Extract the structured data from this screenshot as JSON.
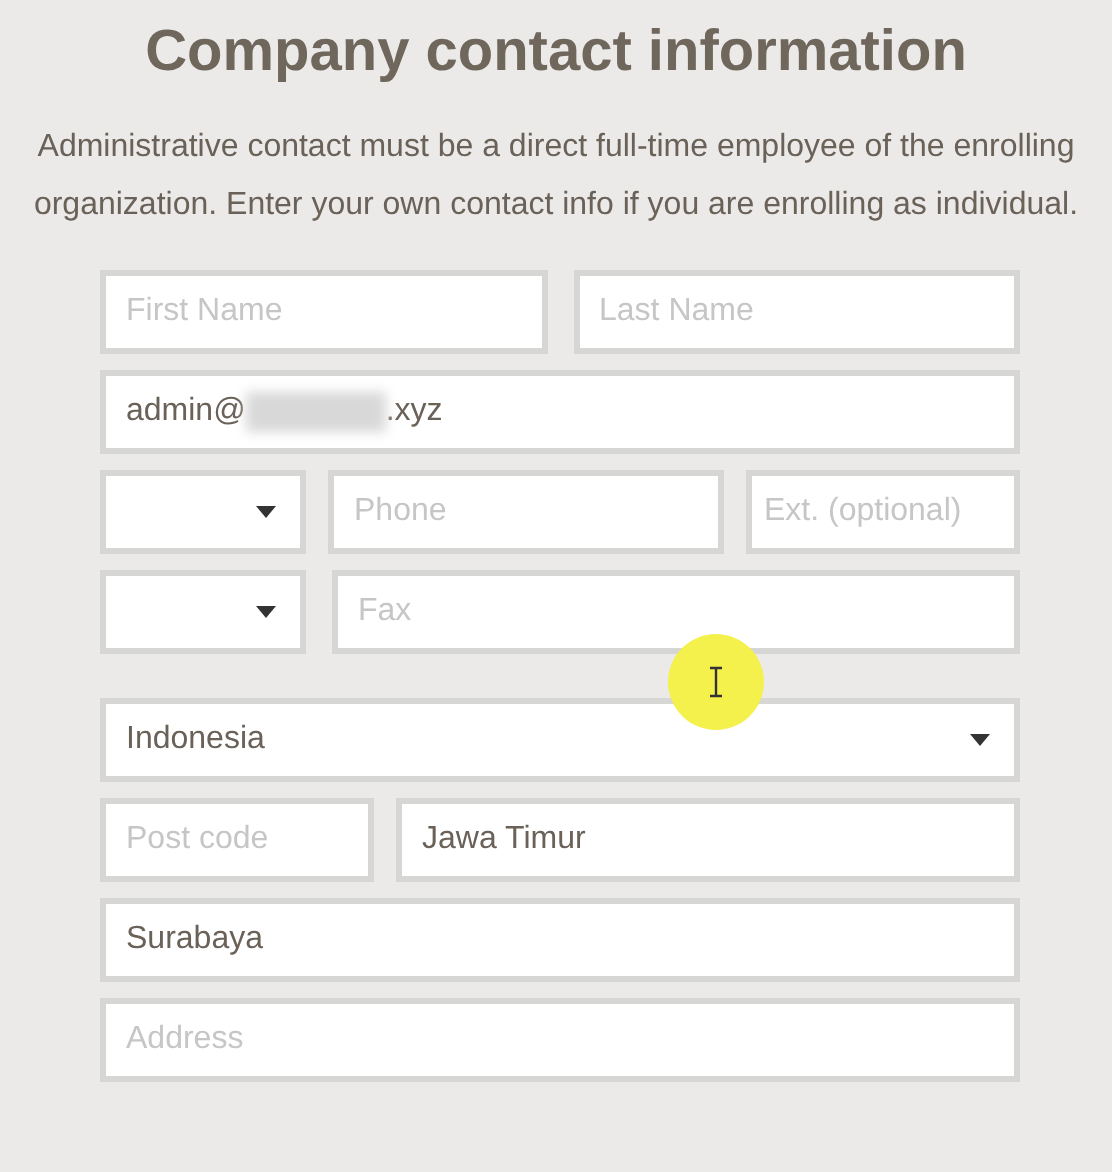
{
  "title": "Company contact information",
  "intro": "Administrative contact must be a direct full-time employee of the enrolling organization. Enter your own contact info if you are enrolling as individual.",
  "groups": [
    {
      "rows": [
        [
          {
            "kind": "text",
            "placeholder": "First Name"
          },
          {
            "kind": "text",
            "placeholder": "Last Name"
          }
        ],
        [
          {
            "kind": "email",
            "value_start": "admin@",
            "value_end": ".xyz"
          }
        ],
        [
          {
            "kind": "select"
          },
          {
            "kind": "text",
            "placeholder": "Phone"
          },
          {
            "kind": "text",
            "placeholder": "Ext. (optional)"
          }
        ],
        [
          {
            "kind": "select"
          },
          {
            "kind": "text",
            "placeholder": "Fax"
          }
        ]
      ]
    },
    {
      "rows": [
        [
          {
            "kind": "select",
            "value": "Indonesia"
          }
        ],
        [
          {
            "kind": "text",
            "placeholder": "Post code"
          },
          {
            "kind": "text",
            "value": "Jawa Timur"
          }
        ],
        [
          {
            "kind": "text",
            "value": "Surabaya"
          }
        ],
        [
          {
            "kind": "text",
            "placeholder": "Address"
          }
        ]
      ]
    }
  ]
}
